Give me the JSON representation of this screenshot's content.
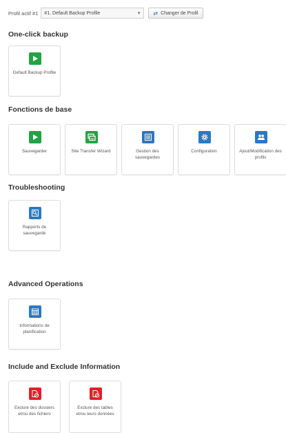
{
  "profile_bar": {
    "label": "Profil actif #1",
    "selected_profile": "#1. Default Backup Profile",
    "switch_button": "Changer de Profil"
  },
  "sections": {
    "one_click": {
      "title": "One-click backup",
      "tiles": [
        {
          "label": "Default Backup Profile",
          "icon": "play-icon",
          "color": "#22a344"
        }
      ]
    },
    "basic": {
      "title": "Fonctions de base",
      "tiles": [
        {
          "label": "Sauvegarder",
          "icon": "play-icon",
          "color": "#22a344"
        },
        {
          "label": "Site Transfer Wizard",
          "icon": "site-transfer-icon",
          "color": "#22a344"
        },
        {
          "label": "Gestion des sauvegardes",
          "icon": "list-icon",
          "color": "#2a79c2"
        },
        {
          "label": "Configuration",
          "icon": "gear-icon",
          "color": "#2a79c2"
        },
        {
          "label": "Ajout/Modification des profils",
          "icon": "users-icon",
          "color": "#2a79c2"
        }
      ]
    },
    "troubleshooting": {
      "title": "Troubleshooting",
      "tiles": [
        {
          "label": "Rapports de sauvegarde",
          "icon": "report-icon",
          "color": "#2a79c2"
        }
      ]
    },
    "advanced": {
      "title": "Advanced Operations",
      "tiles": [
        {
          "label": "Informations de planification",
          "icon": "calendar-icon",
          "color": "#2a79c2"
        }
      ]
    },
    "include_exclude": {
      "title": "Include and Exclude Information",
      "tiles": [
        {
          "label": "Exclure des dossiers et/ou des fichiers",
          "icon": "exclude-files-icon",
          "color": "#e0202a"
        },
        {
          "label": "Exclure des tables et/ou leurs données",
          "icon": "exclude-tables-icon",
          "color": "#e0202a"
        }
      ]
    }
  }
}
